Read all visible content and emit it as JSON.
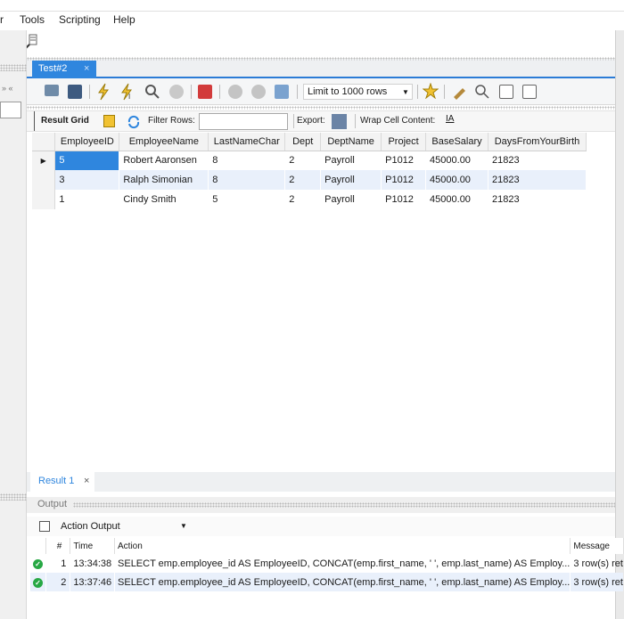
{
  "menu": {
    "partial": "r",
    "tools": "Tools",
    "scripting": "Scripting",
    "help": "Help"
  },
  "left_panel": {
    "arrows": "» «"
  },
  "tab": {
    "label": "Test#2",
    "close": "×"
  },
  "sql_toolbar": {
    "limit": "Limit to 1000 rows"
  },
  "result_toolbar": {
    "result_grid": "Result Grid",
    "filter_rows": "Filter Rows:",
    "export": "Export:",
    "wrap": "Wrap Cell Content:"
  },
  "grid": {
    "columns": [
      "EmployeeID",
      "EmployeeName",
      "LastNameChar",
      "Dept",
      "DeptName",
      "Project",
      "BaseSalary",
      "DaysFromYourBirth"
    ],
    "rows": [
      [
        "5",
        "Robert Aaronsen",
        "8",
        "2",
        "Payroll",
        "P1012",
        "45000.00",
        "21823"
      ],
      [
        "3",
        "Ralph Simonian",
        "8",
        "2",
        "Payroll",
        "P1012",
        "45000.00",
        "21823"
      ],
      [
        "1",
        "Cindy Smith",
        "5",
        "2",
        "Payroll",
        "P1012",
        "45000.00",
        "21823"
      ]
    ]
  },
  "result_tab": {
    "label": "Result 1",
    "close": "×"
  },
  "output": {
    "title": "Output",
    "selector": "Action Output",
    "columns": [
      "#",
      "Time",
      "Action",
      "Message"
    ],
    "rows": [
      {
        "n": "1",
        "time": "13:34:38",
        "action": "SELECT emp.employee_id AS EmployeeID,   CONCAT(emp.first_name, ' ', emp.last_name) AS Employ...",
        "message": "3 row(s) ret"
      },
      {
        "n": "2",
        "time": "13:37:46",
        "action": "SELECT emp.employee_id AS EmployeeID,   CONCAT(emp.first_name, ' ', emp.last_name) AS Employ...",
        "message": "3 row(s) ret"
      }
    ]
  },
  "colors": {
    "accent": "#2f86de",
    "success": "#27a844",
    "row_alt": "#e9f0fb"
  }
}
